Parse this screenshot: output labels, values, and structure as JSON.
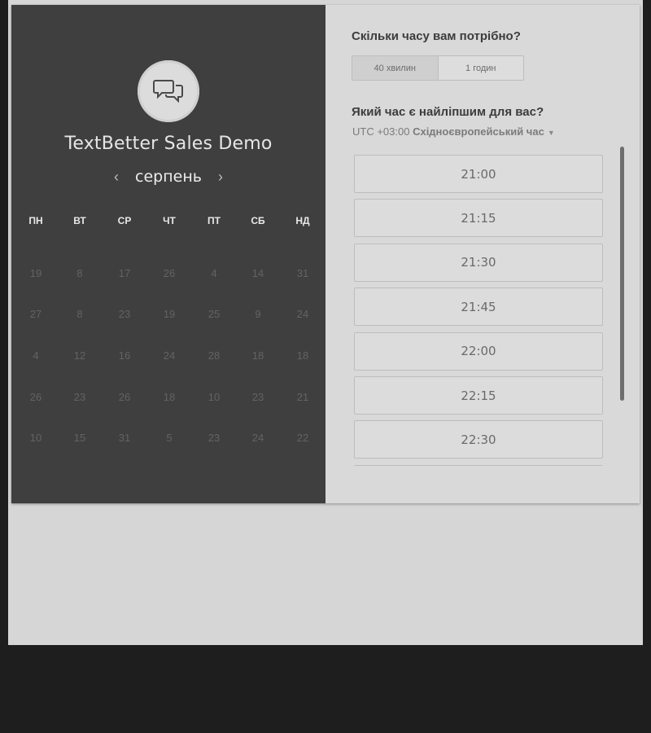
{
  "left_panel": {
    "icon": "chat-bubbles-icon",
    "title": "TextBetter Sales Demo",
    "month": "серпень",
    "prev_icon": "‹",
    "next_icon": "›",
    "weekdays": [
      "ПН",
      "ВТ",
      "СР",
      "ЧТ",
      "ПТ",
      "СБ",
      "НД"
    ],
    "days": [
      [
        "19",
        "8",
        "17",
        "26",
        "4",
        "14",
        "31"
      ],
      [
        "27",
        "8",
        "23",
        "19",
        "25",
        "9",
        "24"
      ],
      [
        "4",
        "12",
        "16",
        "24",
        "28",
        "18",
        "18"
      ],
      [
        "26",
        "23",
        "26",
        "18",
        "10",
        "23",
        "21"
      ],
      [
        "10",
        "15",
        "31",
        "5",
        "23",
        "24",
        "22"
      ]
    ]
  },
  "right_panel": {
    "duration_question": "Скільки часу вам потрібно?",
    "duration_options": [
      "40 хвилин",
      "1 годин"
    ],
    "time_question": "Який час є найліпшим для вас?",
    "timezone_offset": "UTC +03:00",
    "timezone_name": "Східноєвропейський час",
    "slots": [
      "21:00",
      "21:15",
      "21:30",
      "21:45",
      "22:00",
      "22:15",
      "22:30",
      ""
    ]
  }
}
